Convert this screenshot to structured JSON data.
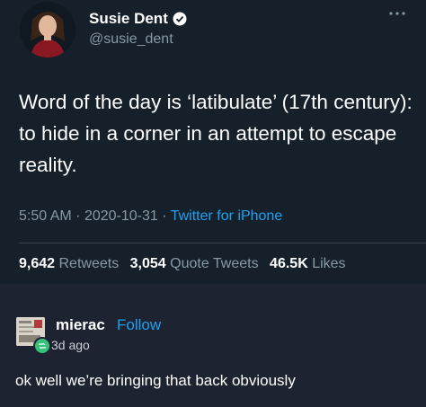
{
  "tweet": {
    "display_name": "Susie Dent",
    "handle": "@susie_dent",
    "verified_icon": "verified-badge-icon",
    "more_icon": "more-horizontal-icon",
    "text": "Word of the day is ‘latibulate’ (17th century): to hide in a corner in an attempt to escape reality.",
    "time": "5:50 AM",
    "date": "2020-10-31",
    "separator": "·",
    "client": "Twitter for iPhone",
    "retweets_count": "9,642",
    "retweets_label": "Retweets",
    "quotes_count": "3,054",
    "quotes_label": "Quote Tweets",
    "likes_count": "46.5K",
    "likes_label": "Likes"
  },
  "post": {
    "username": "mierac",
    "follow_label": "Follow",
    "time_ago": "3d ago",
    "reblog_icon": "reblog-icon",
    "text": "ok well we’re bringing that back obviously"
  },
  "colors": {
    "tweet_bg": "#15202b",
    "post_bg": "#1d2330",
    "accent": "#1da1f2",
    "muted": "#8899a6",
    "reblog_green": "#36c27a"
  }
}
